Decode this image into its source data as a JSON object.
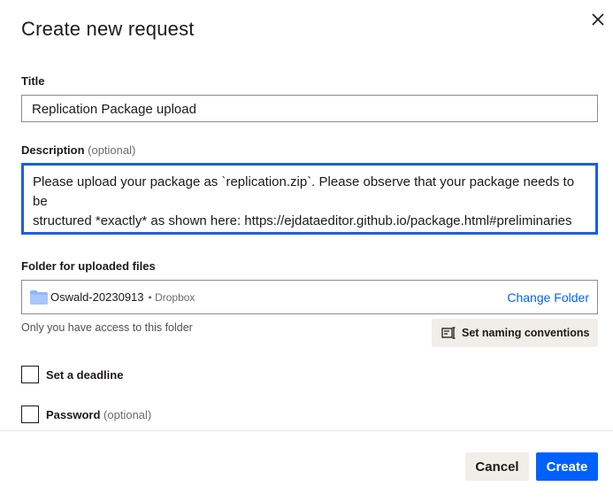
{
  "dialog": {
    "title": "Create new request",
    "close_icon": "close-icon"
  },
  "title_field": {
    "label": "Title",
    "value": "Replication Package upload"
  },
  "description_field": {
    "label": "Description",
    "optional": "(optional)",
    "line1": "Please upload your package as `replication.zip`. Please observe that your package needs to be",
    "line2": "structured *exactly* as shown here: https://ejdataeditor.github.io/package.html#preliminaries"
  },
  "folder": {
    "label": "Folder for uploaded files",
    "name": "Oswald-20230913",
    "separator_source": "• Dropbox",
    "change_label": "Change Folder",
    "access_note": "Only you have access to this folder",
    "naming_label": "Set naming conventions",
    "folder_icon": "folder-icon",
    "naming_icon": "naming-conventions-icon"
  },
  "options": {
    "deadline_label": "Set a deadline",
    "password_label": "Password",
    "password_optional": "(optional)"
  },
  "footer": {
    "cancel_label": "Cancel",
    "create_label": "Create"
  },
  "colors": {
    "accent": "#0061fe",
    "secondary_button": "#f1ede8",
    "text": "#1e1919"
  }
}
